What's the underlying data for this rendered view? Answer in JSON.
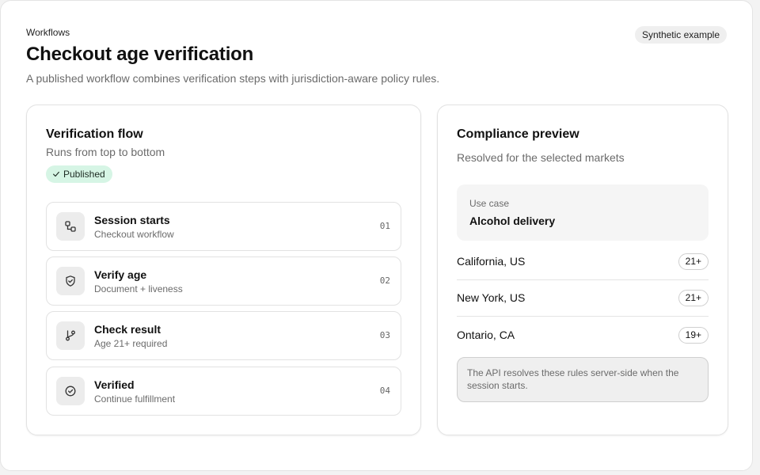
{
  "header": {
    "eyebrow": "Workflows",
    "title": "Checkout age verification",
    "subtitle": "A published workflow combines verification steps with jurisdiction-aware policy rules.",
    "badge": "Synthetic example"
  },
  "flow": {
    "title": "Verification flow",
    "subtitle": "Runs from top to bottom",
    "status": "Published",
    "status_color": "#d6f5e5",
    "steps": [
      {
        "icon": "workflow-nodes-icon",
        "title": "Session starts",
        "detail": "Checkout workflow",
        "number": "01"
      },
      {
        "icon": "shield-check-icon",
        "title": "Verify age",
        "detail": "Document + liveness",
        "number": "02"
      },
      {
        "icon": "git-branch-icon",
        "title": "Check result",
        "detail": "Age 21+ required",
        "number": "03"
      },
      {
        "icon": "check-circle-icon",
        "title": "Verified",
        "detail": "Continue fulfillment",
        "number": "04"
      }
    ]
  },
  "compliance": {
    "title": "Compliance preview",
    "subtitle": "Resolved for the selected markets",
    "use_case": {
      "label": "Use case",
      "value": "Alcohol delivery"
    },
    "markets": [
      {
        "name": "California, US",
        "age": "21+"
      },
      {
        "name": "New York, US",
        "age": "21+"
      },
      {
        "name": "Ontario, CA",
        "age": "19+"
      }
    ],
    "note": "The API resolves these rules server-side when the session starts."
  }
}
